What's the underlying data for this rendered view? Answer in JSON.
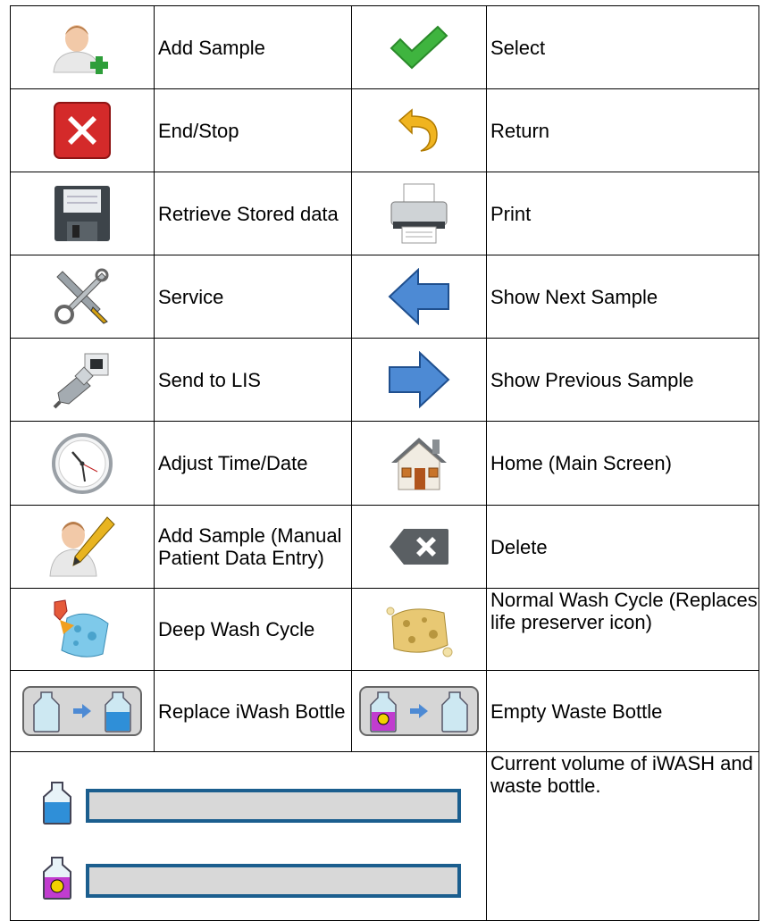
{
  "rows": [
    {
      "left": {
        "icon": "add-user-icon",
        "label": "Add Sample"
      },
      "right": {
        "icon": "checkmark-icon",
        "label": "Select"
      }
    },
    {
      "left": {
        "icon": "end-stop-icon",
        "label": "End/Stop"
      },
      "right": {
        "icon": "return-icon",
        "label": "Return"
      }
    },
    {
      "left": {
        "icon": "floppy-disk-icon",
        "label": "Retrieve Stored data"
      },
      "right": {
        "icon": "printer-icon",
        "label": "Print"
      }
    },
    {
      "left": {
        "icon": "wrench-screwdriver-icon",
        "label": "Service"
      },
      "right": {
        "icon": "arrow-left-icon",
        "label": "Show Next Sample"
      }
    },
    {
      "left": {
        "icon": "network-cable-icon",
        "label": "Send to LIS"
      },
      "right": {
        "icon": "arrow-right-icon",
        "label": "Show Previous Sample"
      }
    },
    {
      "left": {
        "icon": "clock-icon",
        "label": "Adjust Time/Date"
      },
      "right": {
        "icon": "house-icon",
        "label": "Home (Main Screen)"
      }
    },
    {
      "left": {
        "icon": "user-pencil-icon",
        "label": "Add Sample (Manual Patient Data Entry)"
      },
      "right": {
        "icon": "backspace-delete-icon",
        "label": "Delete"
      }
    },
    {
      "left": {
        "icon": "spray-sponge-icon",
        "label": "Deep Wash Cycle"
      },
      "right": {
        "icon": "sponge-icon",
        "label": "Normal Wash Cycle (Replaces life preserver icon)"
      }
    },
    {
      "left": {
        "icon": "bottle-transfer-icon",
        "label": "Replace iWash Bottle"
      },
      "right": {
        "icon": "waste-bottle-transfer-icon",
        "label": "Empty Waste Bottle"
      }
    }
  ],
  "volume": {
    "label": "Current volume of iWASH and waste bottle.",
    "iwash_icon": "iwash-bottle-icon",
    "waste_icon": "waste-bottle-icon"
  },
  "colors": {
    "border": "#000000",
    "bar_fill": "#d8d8d8",
    "bar_border": "#1b5e8e",
    "iwash_liquid": "#2f8fd8",
    "waste_liquid": "#c13ccf",
    "check_green": "#3fb43f",
    "stop_red": "#d42a2a"
  }
}
